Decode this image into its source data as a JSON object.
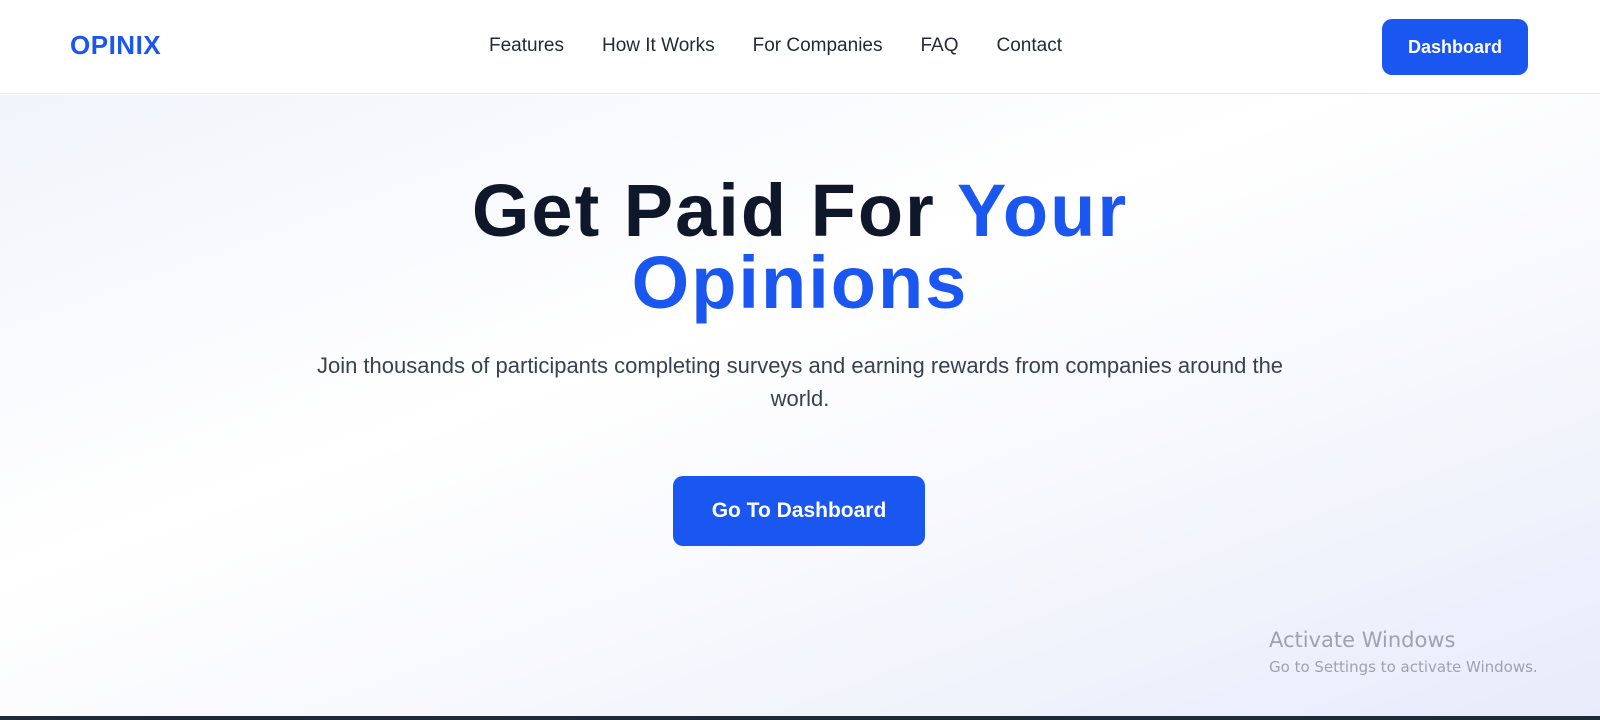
{
  "nav": {
    "logo": "OPINIX",
    "links": [
      "Features",
      "How It Works",
      "For Companies",
      "FAQ",
      "Contact"
    ],
    "dashboard_label": "Dashboard"
  },
  "hero": {
    "title_dark": "Get Paid For ",
    "title_accent_1": "Your",
    "title_accent_2": "Opinions",
    "subtitle": "Join thousands of participants completing surveys and earning rewards from companies around the world.",
    "cta_label": "Go To Dashboard"
  },
  "watermark": {
    "title": "Activate Windows",
    "subtitle": "Go to Settings to activate Windows."
  },
  "colors": {
    "accent": "#1a56f0",
    "heading": "#0f172a",
    "body_text": "#374151"
  }
}
